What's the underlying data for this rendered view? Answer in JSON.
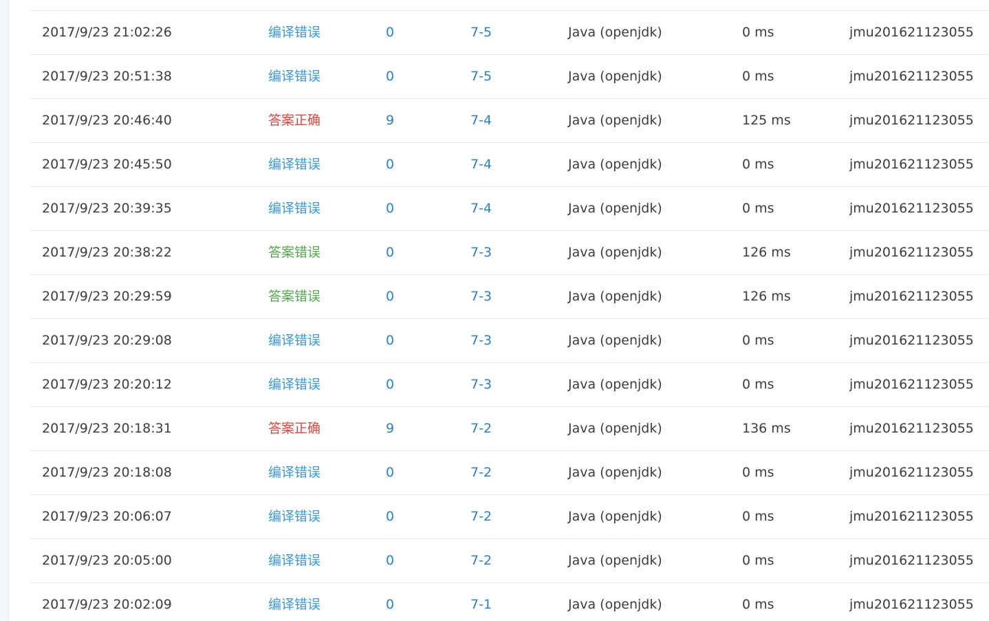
{
  "rows": [
    {
      "time": "2017/9/23 21:02:26",
      "status": "编译错误",
      "status_type": "compile",
      "score": "0",
      "problem": "7-5",
      "lang": "Java (openjdk)",
      "cost": "0 ms",
      "user": "jmu201621123055"
    },
    {
      "time": "2017/9/23 20:51:38",
      "status": "编译错误",
      "status_type": "compile",
      "score": "0",
      "problem": "7-5",
      "lang": "Java (openjdk)",
      "cost": "0 ms",
      "user": "jmu201621123055"
    },
    {
      "time": "2017/9/23 20:46:40",
      "status": "答案正确",
      "status_type": "ac",
      "score": "9",
      "problem": "7-4",
      "lang": "Java (openjdk)",
      "cost": "125 ms",
      "user": "jmu201621123055"
    },
    {
      "time": "2017/9/23 20:45:50",
      "status": "编译错误",
      "status_type": "compile",
      "score": "0",
      "problem": "7-4",
      "lang": "Java (openjdk)",
      "cost": "0 ms",
      "user": "jmu201621123055"
    },
    {
      "time": "2017/9/23 20:39:35",
      "status": "编译错误",
      "status_type": "compile",
      "score": "0",
      "problem": "7-4",
      "lang": "Java (openjdk)",
      "cost": "0 ms",
      "user": "jmu201621123055"
    },
    {
      "time": "2017/9/23 20:38:22",
      "status": "答案错误",
      "status_type": "wa",
      "score": "0",
      "problem": "7-3",
      "lang": "Java (openjdk)",
      "cost": "126 ms",
      "user": "jmu201621123055"
    },
    {
      "time": "2017/9/23 20:29:59",
      "status": "答案错误",
      "status_type": "wa",
      "score": "0",
      "problem": "7-3",
      "lang": "Java (openjdk)",
      "cost": "126 ms",
      "user": "jmu201621123055"
    },
    {
      "time": "2017/9/23 20:29:08",
      "status": "编译错误",
      "status_type": "compile",
      "score": "0",
      "problem": "7-3",
      "lang": "Java (openjdk)",
      "cost": "0 ms",
      "user": "jmu201621123055"
    },
    {
      "time": "2017/9/23 20:20:12",
      "status": "编译错误",
      "status_type": "compile",
      "score": "0",
      "problem": "7-3",
      "lang": "Java (openjdk)",
      "cost": "0 ms",
      "user": "jmu201621123055"
    },
    {
      "time": "2017/9/23 20:18:31",
      "status": "答案正确",
      "status_type": "ac",
      "score": "9",
      "problem": "7-2",
      "lang": "Java (openjdk)",
      "cost": "136 ms",
      "user": "jmu201621123055"
    },
    {
      "time": "2017/9/23 20:18:08",
      "status": "编译错误",
      "status_type": "compile",
      "score": "0",
      "problem": "7-2",
      "lang": "Java (openjdk)",
      "cost": "0 ms",
      "user": "jmu201621123055"
    },
    {
      "time": "2017/9/23 20:06:07",
      "status": "编译错误",
      "status_type": "compile",
      "score": "0",
      "problem": "7-2",
      "lang": "Java (openjdk)",
      "cost": "0 ms",
      "user": "jmu201621123055"
    },
    {
      "time": "2017/9/23 20:05:00",
      "status": "编译错误",
      "status_type": "compile",
      "score": "0",
      "problem": "7-2",
      "lang": "Java (openjdk)",
      "cost": "0 ms",
      "user": "jmu201621123055"
    },
    {
      "time": "2017/9/23 20:02:09",
      "status": "编译错误",
      "status_type": "compile",
      "score": "0",
      "problem": "7-1",
      "lang": "Java (openjdk)",
      "cost": "0 ms",
      "user": "jmu201621123055"
    }
  ],
  "colors": {
    "compile": "#3a98d8",
    "ac": "#e0463c",
    "wa": "#52a84a",
    "link": "#2f7fc1"
  }
}
